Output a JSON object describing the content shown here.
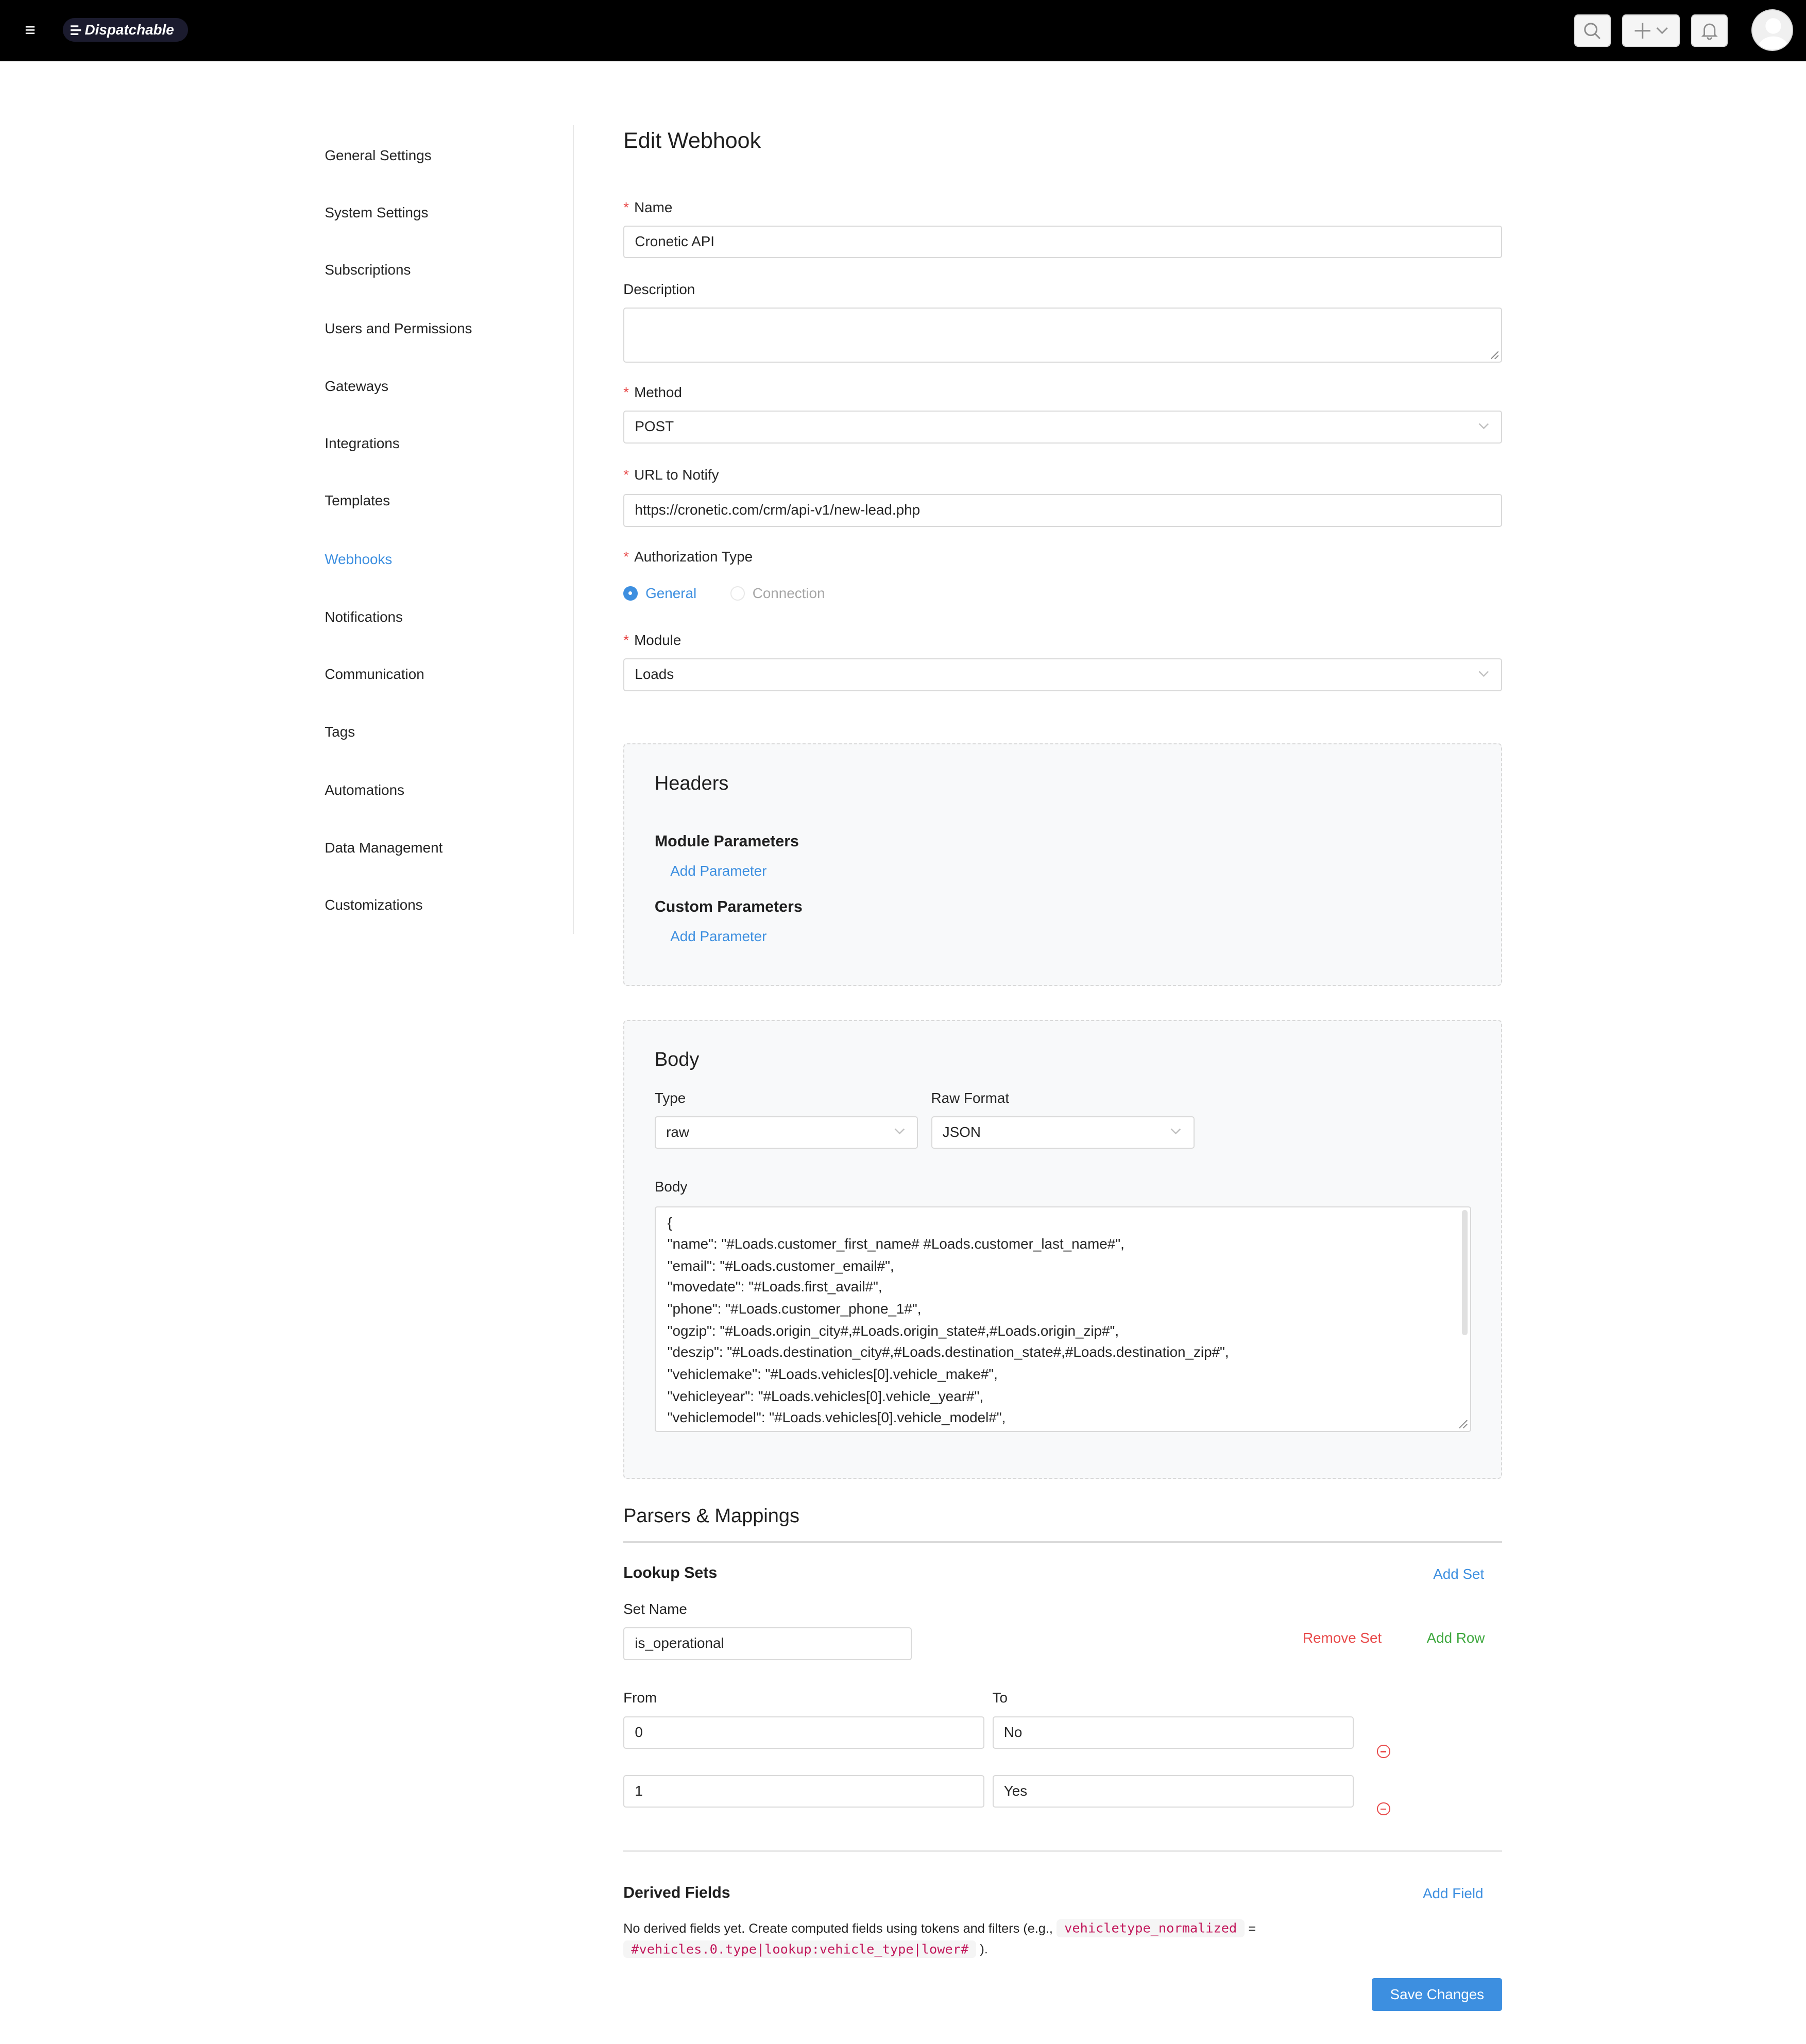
{
  "app": {
    "brand": "Dispatchable",
    "menu_glyph": "≡"
  },
  "topbar": {
    "search_icon": "search-icon",
    "add_icon": "plus-icon",
    "bell_icon": "bell-icon",
    "avatar": "user-avatar"
  },
  "sidebar": {
    "items": [
      {
        "label": "General Settings",
        "active": false
      },
      {
        "label": "System Settings",
        "active": false
      },
      {
        "label": "Subscriptions",
        "active": false
      },
      {
        "label": "Users and Permissions",
        "active": false
      },
      {
        "label": "Gateways",
        "active": false
      },
      {
        "label": "Integrations",
        "active": false
      },
      {
        "label": "Templates",
        "active": false
      },
      {
        "label": "Webhooks",
        "active": true
      },
      {
        "label": "Notifications",
        "active": false
      },
      {
        "label": "Communication",
        "active": false
      },
      {
        "label": "Tags",
        "active": false
      },
      {
        "label": "Automations",
        "active": false
      },
      {
        "label": "Data Management",
        "active": false
      },
      {
        "label": "Customizations",
        "active": false
      }
    ]
  },
  "form": {
    "title": "Edit Webhook",
    "required_mark": "*",
    "name": {
      "label": "Name",
      "value": "Cronetic API"
    },
    "description": {
      "label": "Description",
      "value": ""
    },
    "method": {
      "label": "Method",
      "value": "POST"
    },
    "url": {
      "label": "URL to Notify",
      "value": "https://cronetic.com/crm/api-v1/new-lead.php"
    },
    "auth": {
      "label": "Authorization Type",
      "options": [
        "General",
        "Connection"
      ],
      "selected": "General"
    },
    "module": {
      "label": "Module",
      "value": "Loads"
    }
  },
  "headers": {
    "title": "Headers",
    "module_params": {
      "title": "Module Parameters",
      "add_label": "Add Parameter"
    },
    "custom_params": {
      "title": "Custom Parameters",
      "add_label": "Add Parameter"
    }
  },
  "body": {
    "title": "Body",
    "type": {
      "label": "Type",
      "value": "raw"
    },
    "raw_format": {
      "label": "Raw Format",
      "value": "JSON"
    },
    "body_label": "Body",
    "lines": [
      "{",
      "\"name\": \"#Loads.customer_first_name# #Loads.customer_last_name#\",",
      "\"email\": \"#Loads.customer_email#\",",
      "\"movedate\": \"#Loads.first_avail#\",",
      "\"phone\": \"#Loads.customer_phone_1#\",",
      "\"ogzip\": \"#Loads.origin_city#,#Loads.origin_state#,#Loads.origin_zip#\",",
      "\"deszip\": \"#Loads.destination_city#,#Loads.destination_state#,#Loads.destination_zip#\",",
      "\"vehiclemake\": \"#Loads.vehicles[0].vehicle_make#\",",
      "\"vehicleyear\": \"#Loads.vehicles[0].vehicle_year#\",",
      "\"vehiclemodel\": \"#Loads.vehicles[0].vehicle_model#\","
    ]
  },
  "parsers": {
    "title": "Parsers & Mappings",
    "lookup": {
      "title": "Lookup Sets",
      "add_set": "Add Set",
      "set_name_label": "Set Name",
      "set_name": "is_operational",
      "remove_set": "Remove Set",
      "add_row": "Add Row",
      "from_label": "From",
      "to_label": "To",
      "rows": [
        {
          "from": "0",
          "to": "No"
        },
        {
          "from": "1",
          "to": "Yes"
        }
      ]
    },
    "derived": {
      "title": "Derived Fields",
      "add_field": "Add Field",
      "text_before": "No derived fields yet. Create computed fields using tokens and filters (e.g.,",
      "code1": "vehicletype_normalized",
      "equals": "=",
      "code2": "#vehicles.0.type|lookup:vehicle_type|lower#",
      "text_after": ")."
    }
  },
  "save_label": "Save Changes",
  "colors": {
    "accent": "#3d8fe0",
    "danger": "#e84a4a",
    "success": "#3fa83f",
    "topbar": "#000000"
  }
}
